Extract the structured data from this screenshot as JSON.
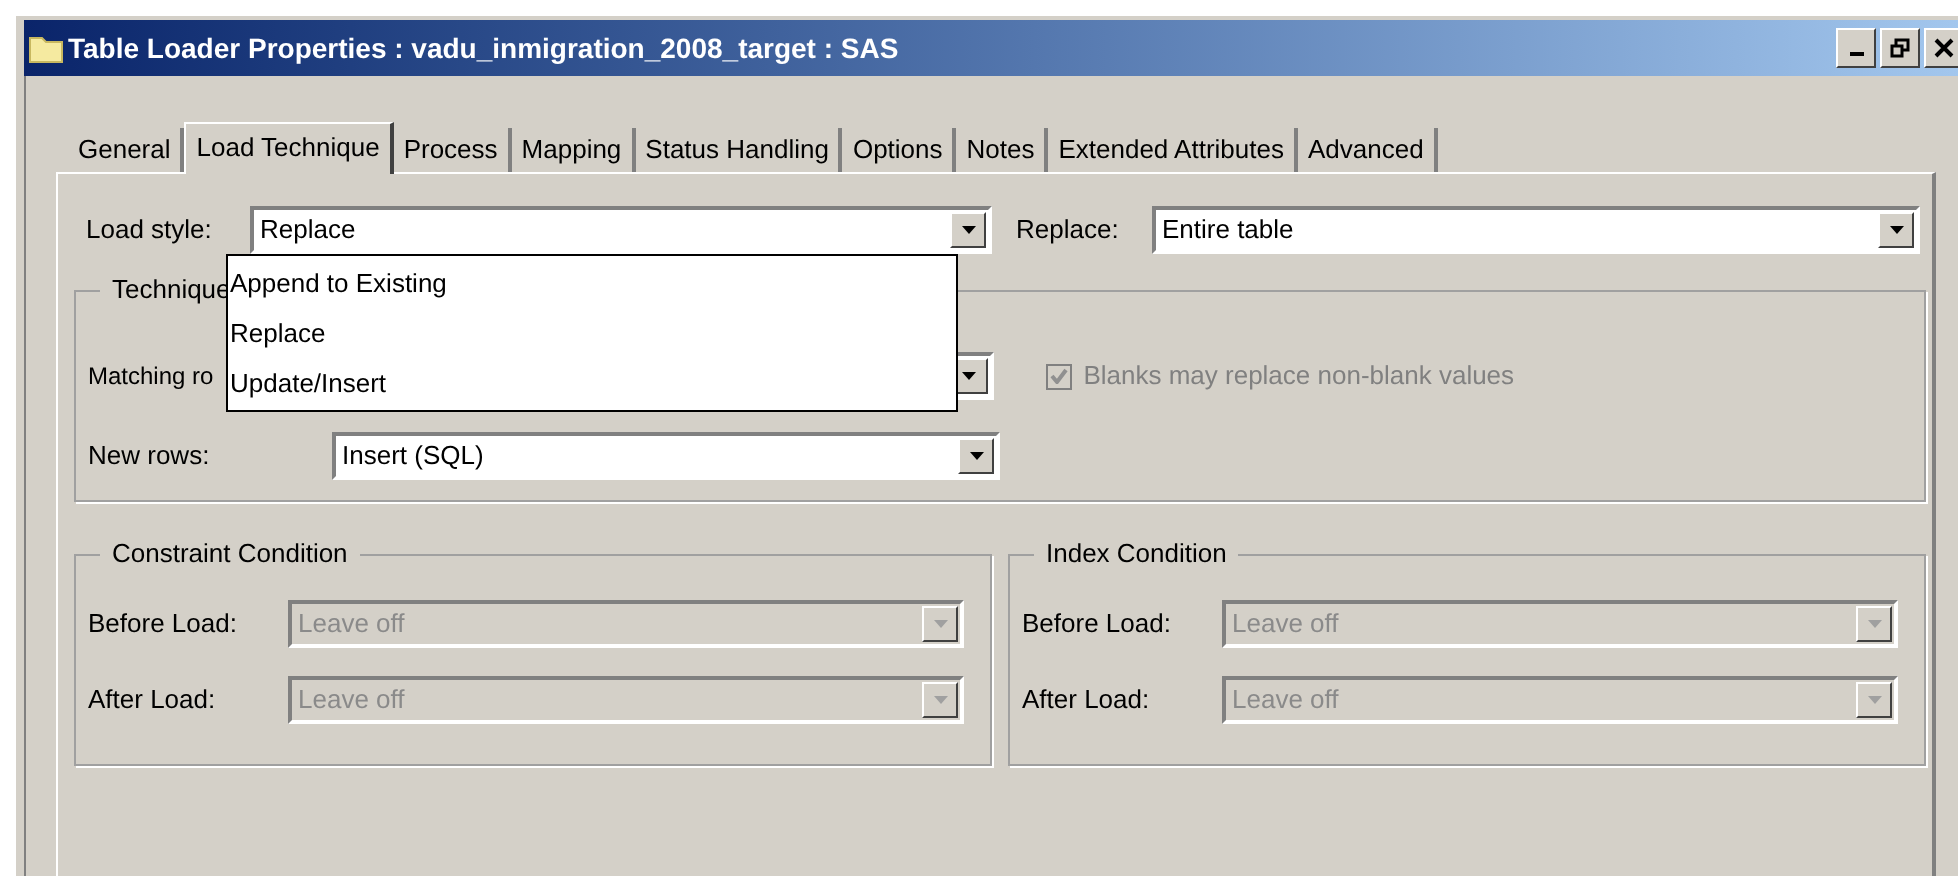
{
  "window": {
    "title": "Table Loader Properties : vadu_inmigration_2008_target : SAS"
  },
  "tabs": [
    {
      "label": "General",
      "selected": false
    },
    {
      "label": "Load Technique",
      "selected": true
    },
    {
      "label": "Process",
      "selected": false
    },
    {
      "label": "Mapping",
      "selected": false
    },
    {
      "label": "Status Handling",
      "selected": false
    },
    {
      "label": "Options",
      "selected": false
    },
    {
      "label": "Notes",
      "selected": false
    },
    {
      "label": "Extended Attributes",
      "selected": false
    },
    {
      "label": "Advanced",
      "selected": false
    }
  ],
  "load_style": {
    "label": "Load style:",
    "value": "Replace",
    "expanded": true,
    "options": [
      "Append to Existing",
      "Replace",
      "Update/Insert"
    ]
  },
  "replace": {
    "label": "Replace:",
    "value": "Entire table"
  },
  "technique": {
    "title": "Technique",
    "matching_rows": {
      "label": "Matching ro"
    },
    "new_rows": {
      "label": "New rows:",
      "value": "Insert (SQL)"
    },
    "blanks": {
      "label": "Blanks may replace non-blank values",
      "checked": true,
      "disabled": true
    }
  },
  "groups": [
    {
      "title": "Constraint Condition",
      "rows": [
        {
          "label": "Before Load:",
          "value": "Leave off",
          "disabled": true
        },
        {
          "label": "After Load:",
          "value": "Leave off",
          "disabled": true
        }
      ]
    },
    {
      "title": "Index Condition",
      "rows": [
        {
          "label": "Before Load:",
          "value": "Leave off",
          "disabled": true
        },
        {
          "label": "After Load:",
          "value": "Leave off",
          "disabled": true
        }
      ]
    }
  ]
}
